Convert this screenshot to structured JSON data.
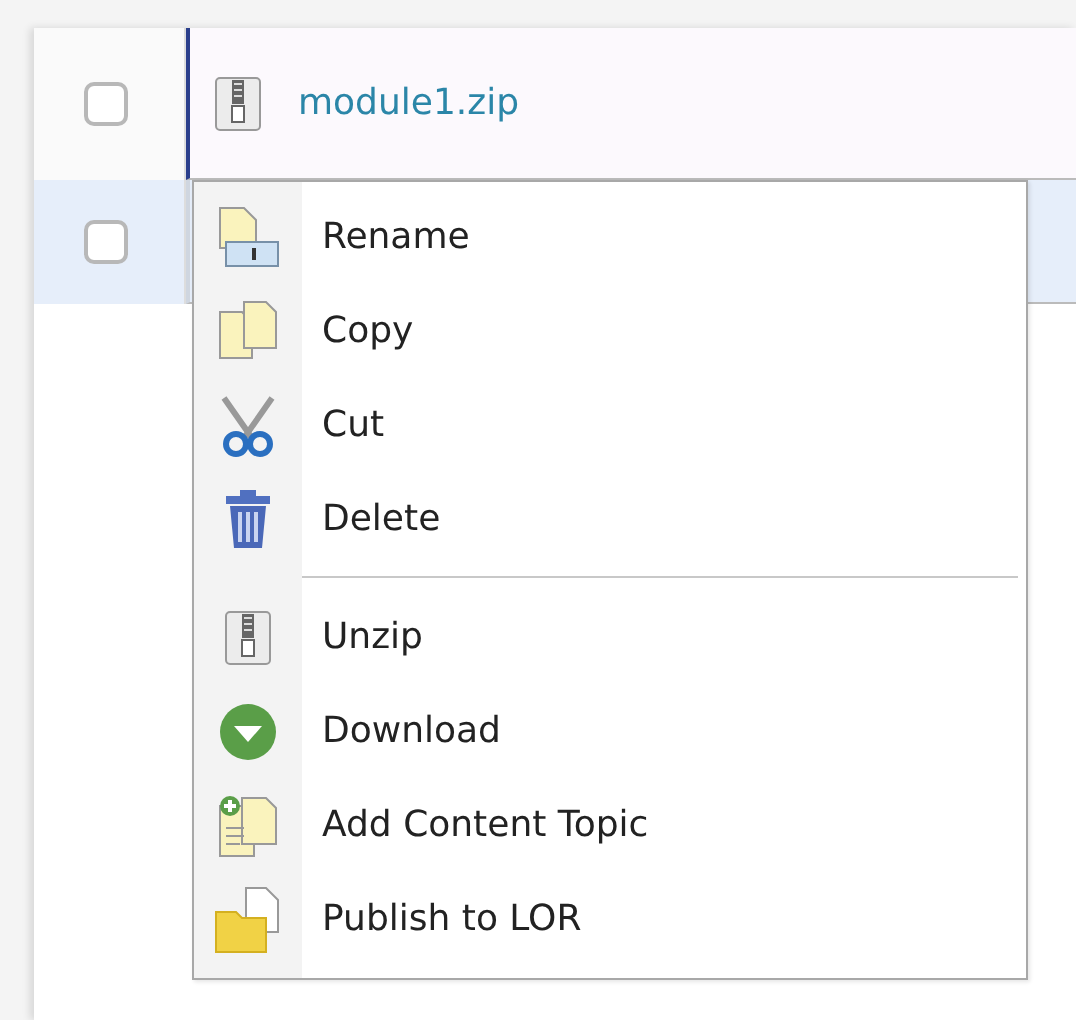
{
  "rows": [
    {
      "checked": false,
      "selected": true,
      "hovered": false,
      "kind": "zip",
      "name": "module1.zip"
    },
    {
      "checked": false,
      "selected": false,
      "hovered": true
    }
  ],
  "context_menu": {
    "groups": [
      [
        {
          "label": "Rename",
          "kind": "rename"
        },
        {
          "label": "Copy",
          "kind": "copy"
        },
        {
          "label": "Cut",
          "kind": "cut"
        },
        {
          "label": "Delete",
          "kind": "delete"
        }
      ],
      [
        {
          "label": "Unzip",
          "kind": "zip"
        },
        {
          "label": "Download",
          "kind": "download"
        },
        {
          "label": "Add Content Topic",
          "kind": "addtopic"
        },
        {
          "label": "Publish to LOR",
          "kind": "publish"
        }
      ]
    ]
  }
}
